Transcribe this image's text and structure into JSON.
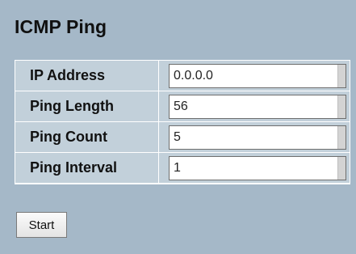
{
  "page": {
    "title": "ICMP Ping"
  },
  "form": {
    "fields": [
      {
        "label": "IP Address",
        "value": "0.0.0.0"
      },
      {
        "label": "Ping Length",
        "value": "56"
      },
      {
        "label": "Ping Count",
        "value": "5"
      },
      {
        "label": "Ping Interval",
        "value": "1"
      }
    ]
  },
  "actions": {
    "start_label": "Start"
  },
  "colors": {
    "background": "#a5b8c8",
    "row_background": "#c2d0da"
  }
}
